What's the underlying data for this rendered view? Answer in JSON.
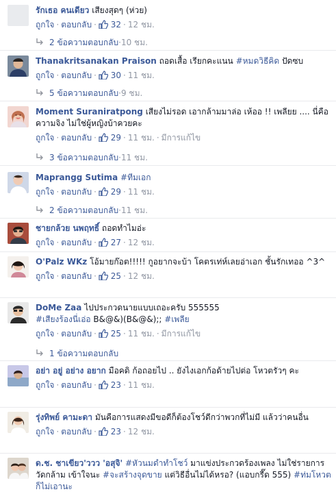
{
  "labels": {
    "like": "ถูกใจ",
    "reply": "ตอบกลับ",
    "dot": "·",
    "edited": "มีการแก้ไข"
  },
  "comments": [
    {
      "name": "รักเธอ คนเดียว",
      "text": "เสียงสุดๆ (ห่วย)",
      "likes": "32",
      "time": "12 ชม.",
      "replies": {
        "label": "2 ข้อความตอบกลับ",
        "time": "10 ชม."
      }
    },
    {
      "name": "Thanakritsanakan Praison",
      "text": "ถอดเสื้อ เรียกคะแนน ",
      "tag": "#หมดวิธีคิด",
      "text2": " ปัดซบ",
      "likes": "30",
      "time": "11 ชม.",
      "replies": {
        "label": "5 ข้อความตอบกลับ",
        "time": "9 ชม."
      }
    },
    {
      "name": "Moment Suraniratpong",
      "text": "เสียงไม่รอด เอากล้ามมาล่อ เห้ออ !! เพลียย .... นี่คือความจิง ไม่ใช่ผู้หญิงบ้าควยคะ",
      "likes": "29",
      "time": "11 ชม.",
      "edited": true,
      "replies": {
        "label": "3 ข้อความตอบกลับ",
        "time": "11 ชม."
      }
    },
    {
      "name": "Maprangg Sutima",
      "tag": "#ทีมเอก",
      "likes": "29",
      "time": "11 ชม.",
      "replies": {
        "label": "2 ข้อความตอบกลับ",
        "time": "11 ชม."
      }
    },
    {
      "name": "ชายกล้วย นพฤทธิ์",
      "text": "ถอดทำไมอ่ะ",
      "likes": "27",
      "time": "12 ชม."
    },
    {
      "name": "O'Palz WKz",
      "text": "โอ้มายก๊อต!!!!! กูอยากจะบ้า โคตรเท่ห์เลยอ่าเอก ชั้นรักเทออ ^3^",
      "likes": "25",
      "time": "12 ชม."
    },
    {
      "name": "DoMe Zaa",
      "text": "ไปประกวดนายแบบเถอะครับ 555555",
      "tag": "#เสียงร้องนี่เอ่อ",
      "text2": " B&@&)(B&@&);; ",
      "tag2": "#เพลีย",
      "likes": "25",
      "time": "11 ชม.",
      "edited": true,
      "replies": {
        "label": "1 ข้อความตอบกลับ"
      }
    },
    {
      "name": "อย่า อยู่ อย่าง อยาก",
      "text": "มือคดิ ก้อถอยไป .. ยังไงเอกก้อด้ายไปต่อ โหวตรัวๆ คะ",
      "likes": "23",
      "time": "11 ชม."
    },
    {
      "name": "รุ่งทิพย์ คามะดา",
      "text": "มันคือการแสดงมีขอดีก็ต้องโชว์ดีกว่าพวกที่ไม่มี แล้วว่าคนอื่น",
      "likes": "23",
      "time": "12 ชม."
    },
    {
      "name": "ด.ช. ชาเขียว'ววว 'อสุจิ'",
      "tag": "#หัวนมดำทำโชว์",
      "text": " มาแข่งประกวดร้องเพลง ไม่ใช่รายการ วัดกล้าม เข้าใจนะ ",
      "tag2": "#จะสร้างจุดขาย",
      "text2": " แต่วิธีอื่นไม่ได้หรอ? (แอบกรี๊ด 555) ",
      "tag3": "#ท่มโหวตก็ไม่เอานะ"
    }
  ]
}
